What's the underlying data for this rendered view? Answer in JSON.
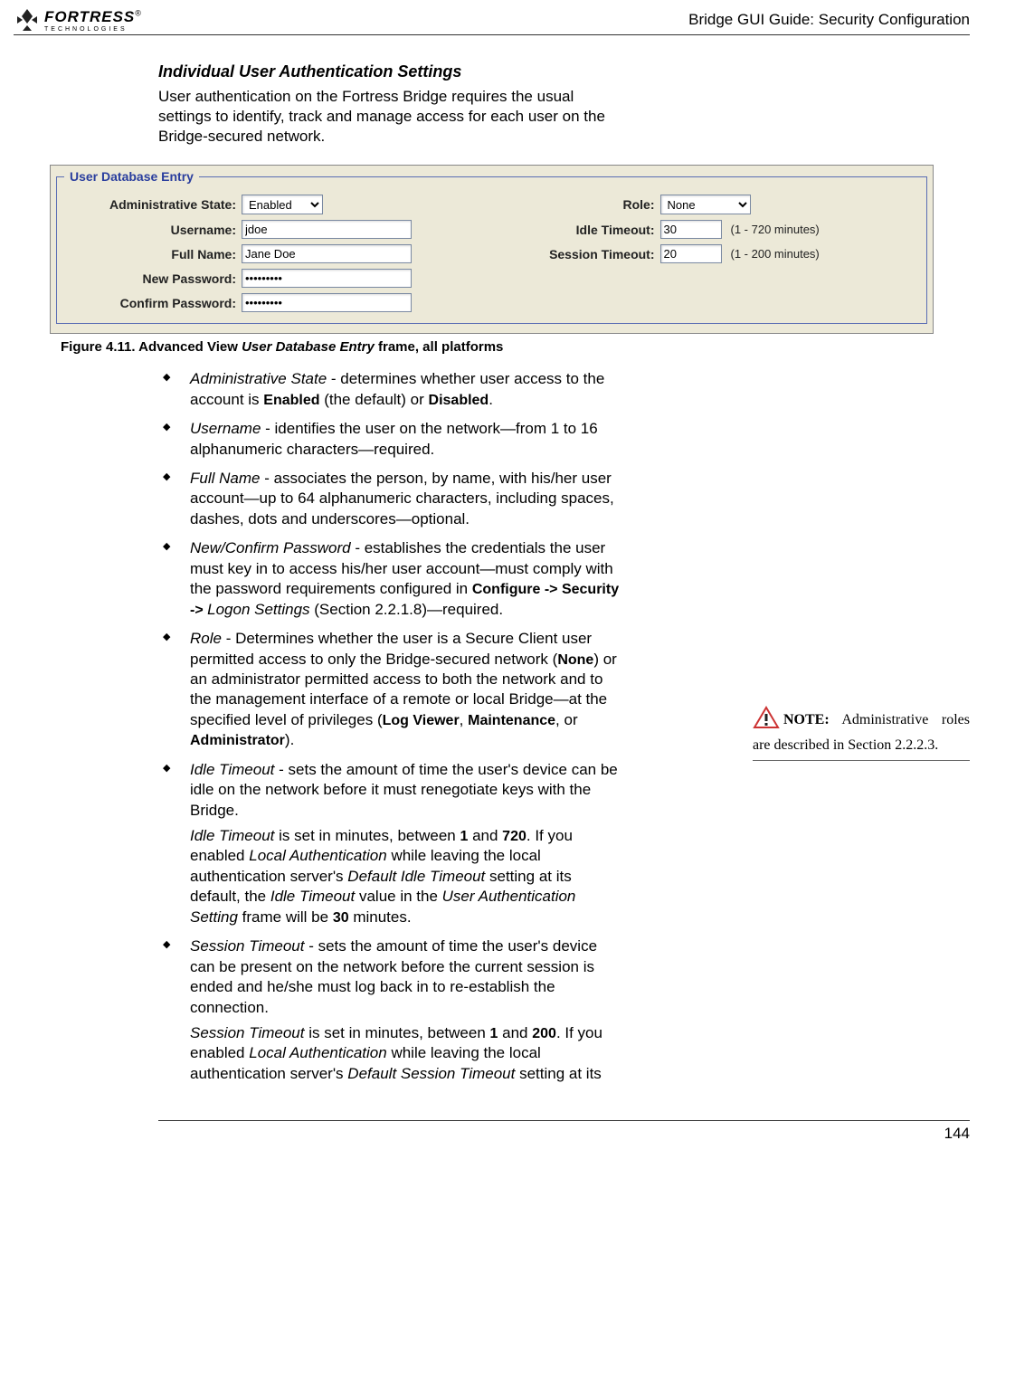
{
  "header": {
    "logo_main": "FORTRESS",
    "logo_sub": "TECHNOLOGIES",
    "reg": "®",
    "doc_path": "Bridge GUI Guide: Security Configuration"
  },
  "section": {
    "title": "Individual User Authentication Settings",
    "intro": "User authentication on the Fortress Bridge requires the usual settings to identify, track and manage access for each user on the Bridge-secured network."
  },
  "screenshot": {
    "legend": "User Database Entry",
    "left": {
      "admin_state_label": "Administrative State:",
      "admin_state_value": "Enabled",
      "username_label": "Username:",
      "username_value": "jdoe",
      "fullname_label": "Full Name:",
      "fullname_value": "Jane Doe",
      "newpass_label": "New Password:",
      "newpass_value": "•••••••••",
      "confpass_label": "Confirm Password:",
      "confpass_value": "•••••••••"
    },
    "right": {
      "role_label": "Role:",
      "role_value": "None",
      "idle_label": "Idle Timeout:",
      "idle_value": "30",
      "idle_hint": "(1 - 720 minutes)",
      "sess_label": "Session Timeout:",
      "sess_value": "20",
      "sess_hint": "(1 - 200 minutes)"
    }
  },
  "figure": {
    "prefix": "Figure 4.11. Advanced View ",
    "italic": "User Database Entry",
    "suffix": " frame, all platforms"
  },
  "bullets": {
    "b1_term": "Administrative State",
    "b1_text": " - determines whether user access to the account is ",
    "b1_enabled": "Enabled",
    "b1_mid": " (the default) or ",
    "b1_disabled": "Disabled",
    "b1_end": ".",
    "b2_term": "Username",
    "b2_text": " - identifies the user on the network—from 1 to 16 alphanumeric characters—required.",
    "b3_term": "Full Name",
    "b3_text": " - associates the person, by name, with his/her user account—up to 64 alphanumeric characters, including spaces, dashes, dots and underscores—optional.",
    "b4_term": "New/Confirm Password",
    "b4_text": " - establishes the credentials the user must key in to access his/her user account—must comply with the password requirements configured in ",
    "b4_path": "Configure -> Security -> ",
    "b4_logon": "Logon Settings",
    "b4_sec": " (Section 2.2.1.8)—required.",
    "b5_term": "Role",
    "b5_text1": " - Determines whether the user is a Secure Client user permitted access to only the Bridge-secured network (",
    "b5_none": "None",
    "b5_text2": ") or an administrator permitted access to both the network and to the management interface of a remote or local Bridge—at the specified level of privileges (",
    "b5_lv": "Log Viewer",
    "b5_comma": ", ",
    "b5_mt": "Maintenance",
    "b5_or": ", or ",
    "b5_ad": "Administrator",
    "b5_end": ").",
    "b6_term": "Idle Timeout",
    "b6_text": " - sets the amount of time the user's device can be idle on the network before it must renegotiate keys with the Bridge.",
    "b6_sub_i": "Idle Timeout",
    "b6_sub1": " is set in minutes, between ",
    "b6_1": "1",
    "b6_and": " and ",
    "b6_720": "720",
    "b6_sub2": ". If you enabled ",
    "b6_la": "Local Authentication",
    "b6_sub3": " while leaving the local authentication server's ",
    "b6_dit": "Default Idle Timeout",
    "b6_sub4": " setting at its default, the ",
    "b6_it2": "Idle Timeout",
    "b6_sub5": " value in the ",
    "b6_uas": "User Authentication Setting",
    "b6_sub6": " frame will be ",
    "b6_30": "30",
    "b6_sub7": " minutes.",
    "b7_term": "Session Timeout",
    "b7_text": " - sets the amount of time the user's device can be present on the network before the current session is ended and he/she must log back in to re-establish the connection.",
    "b7_sub_i": "Session Timeout",
    "b7_sub1": " is set in minutes, between ",
    "b7_1": "1",
    "b7_and": " and ",
    "b7_200": "200",
    "b7_sub2": ". If you enabled ",
    "b7_la": "Local Authentication",
    "b7_sub3": " while leaving the local authentication server's ",
    "b7_dst": "Default Session Timeout",
    "b7_sub4": " setting at its"
  },
  "note": {
    "label": "NOTE:",
    "text": " Administrative roles are described in Section 2.2.2.3."
  },
  "footer": {
    "page": "144"
  }
}
